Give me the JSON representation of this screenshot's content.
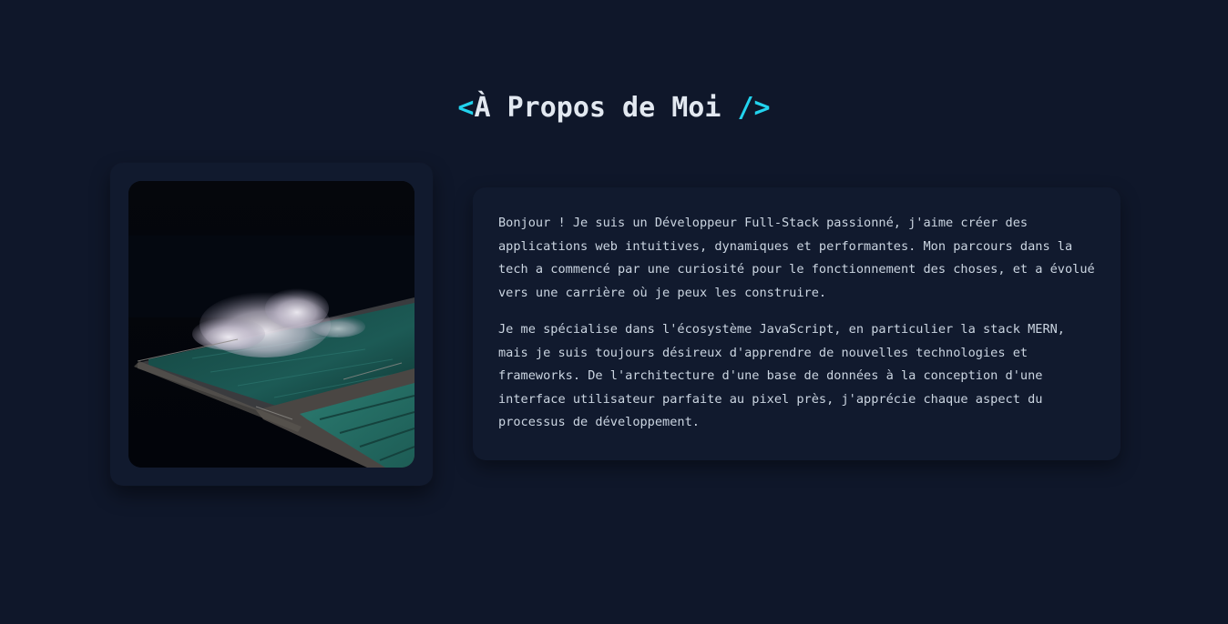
{
  "section": {
    "title_open": "<",
    "title_text": "À Propos de Moi",
    "title_close": "/>"
  },
  "photo": {
    "icon": "image",
    "subject": "night sea pool with crashing wave"
  },
  "bio": {
    "paragraph_1": "Bonjour ! Je suis un Développeur Full-Stack passionné, j'aime créer des applications web intuitives, dynamiques et performantes. Mon parcours dans la tech a commencé par une curiosité pour le fonctionnement des choses, et a évolué vers une carrière où je peux les construire.",
    "paragraph_2": "Je me spécialise dans l'écosystème JavaScript, en particulier la stack MERN, mais je suis toujours désireux d'apprendre de nouvelles technologies et frameworks. De l'architecture d'une base de données à la conception d'une interface utilisateur parfaite au pixel près, j'apprécie chaque aspect du processus de développement."
  },
  "colors": {
    "background": "#0f172a",
    "card": "#111a2e",
    "accent": "#22d3ee",
    "heading": "#e2e8f0",
    "body_text": "#cbd5e1"
  }
}
